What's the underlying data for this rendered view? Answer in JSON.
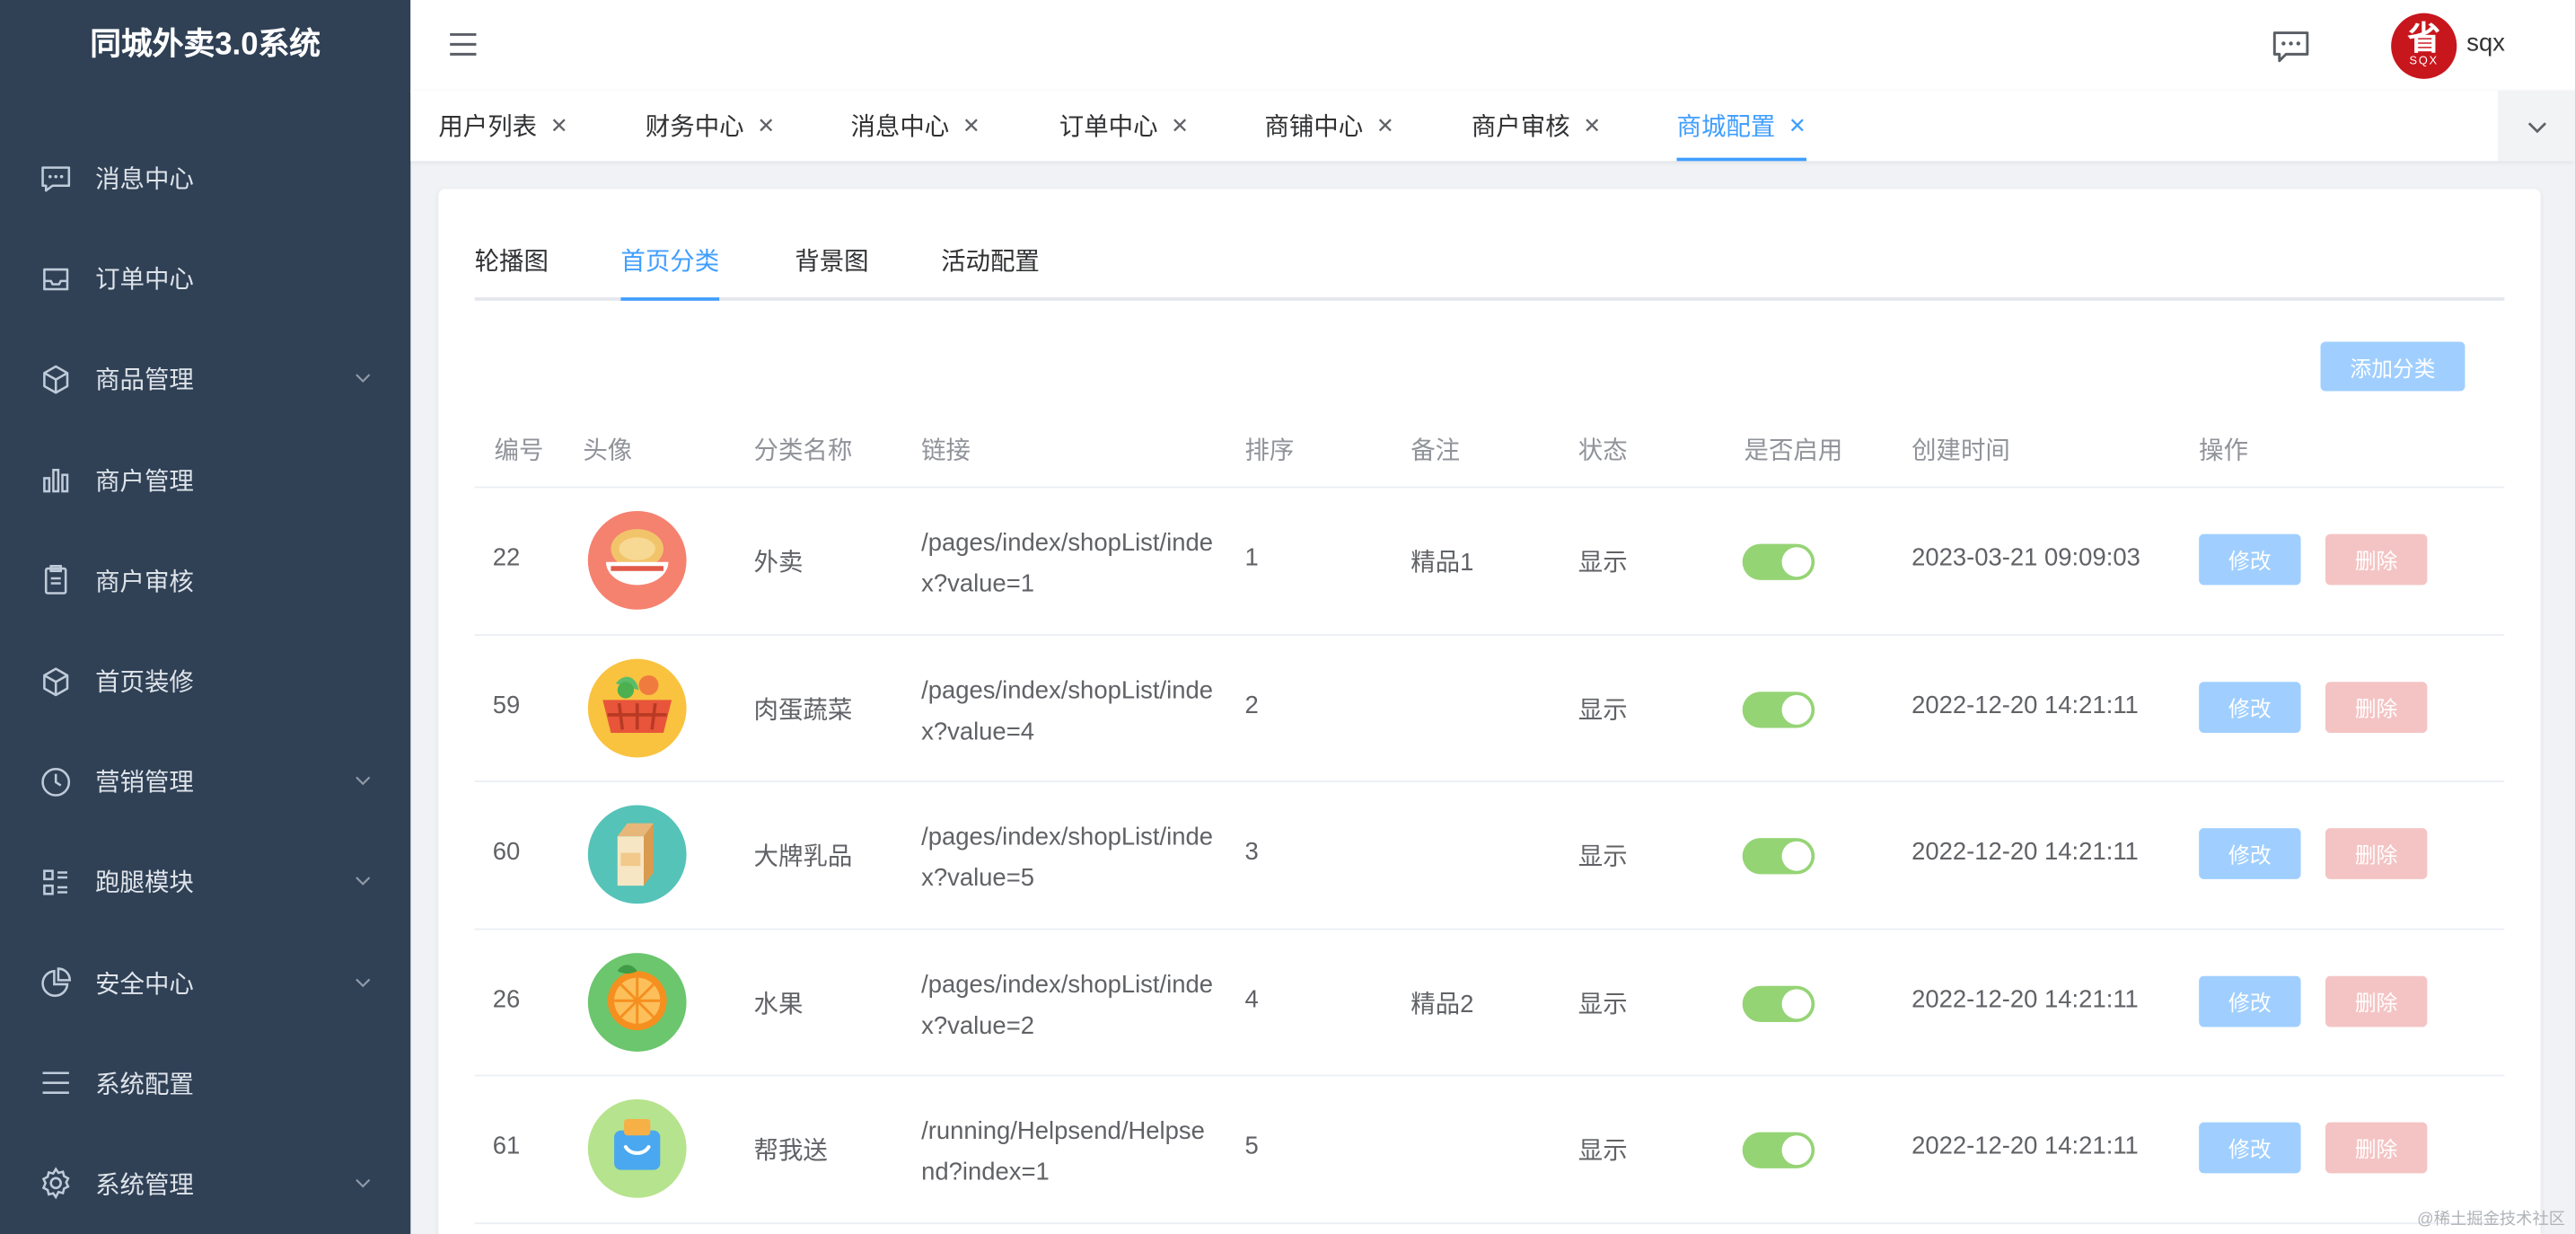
{
  "app": {
    "title": "同城外卖3.0系统"
  },
  "sidebar": {
    "items": [
      {
        "label": "消息中心",
        "icon": "message-icon",
        "has_arrow": false
      },
      {
        "label": "订单中心",
        "icon": "inbox-icon",
        "has_arrow": false
      },
      {
        "label": "商品管理",
        "icon": "box-icon",
        "has_arrow": true
      },
      {
        "label": "商户管理",
        "icon": "bar-chart-icon",
        "has_arrow": false
      },
      {
        "label": "商户审核",
        "icon": "clipboard-icon",
        "has_arrow": false
      },
      {
        "label": "首页装修",
        "icon": "box-icon",
        "has_arrow": false
      },
      {
        "label": "营销管理",
        "icon": "clock-icon",
        "has_arrow": true
      },
      {
        "label": "跑腿模块",
        "icon": "list-icon",
        "has_arrow": true
      },
      {
        "label": "安全中心",
        "icon": "pie-chart-icon",
        "has_arrow": true
      },
      {
        "label": "系统配置",
        "icon": "menu-icon",
        "has_arrow": false
      },
      {
        "label": "系统管理",
        "icon": "gear-icon",
        "has_arrow": true
      }
    ]
  },
  "header": {
    "avatar": {
      "main": "省",
      "sub": "SQX"
    },
    "username": "sqx"
  },
  "tags": [
    {
      "label": "用户列表",
      "active": false
    },
    {
      "label": "财务中心",
      "active": false
    },
    {
      "label": "消息中心",
      "active": false
    },
    {
      "label": "订单中心",
      "active": false
    },
    {
      "label": "商铺中心",
      "active": false
    },
    {
      "label": "商户审核",
      "active": false
    },
    {
      "label": "商城配置",
      "active": true
    }
  ],
  "sub_tabs": [
    {
      "label": "轮播图",
      "active": false
    },
    {
      "label": "首页分类",
      "active": true
    },
    {
      "label": "背景图",
      "active": false
    },
    {
      "label": "活动配置",
      "active": false
    }
  ],
  "actions": {
    "add_label": "添加分类"
  },
  "table": {
    "columns": [
      "编号",
      "头像",
      "分类名称",
      "链接",
      "排序",
      "备注",
      "状态",
      "是否启用",
      "创建时间",
      "操作"
    ],
    "rows": [
      {
        "id": "22",
        "image": "bowl-icon",
        "name": "外卖",
        "link": "/pages/index/shopList/index?value=1",
        "sort": "1",
        "remark": "精品1",
        "status": "显示",
        "enabled": true,
        "created": "2023-03-21 09:09:03",
        "edit": "修改",
        "delete": "删除"
      },
      {
        "id": "59",
        "image": "basket-icon",
        "name": "肉蛋蔬菜",
        "link": "/pages/index/shopList/index?value=4",
        "sort": "2",
        "remark": "",
        "status": "显示",
        "enabled": true,
        "created": "2022-12-20 14:21:11",
        "edit": "修改",
        "delete": "删除"
      },
      {
        "id": "60",
        "image": "milk-icon",
        "name": "大牌乳品",
        "link": "/pages/index/shopList/index?value=5",
        "sort": "3",
        "remark": "",
        "status": "显示",
        "enabled": true,
        "created": "2022-12-20 14:21:11",
        "edit": "修改",
        "delete": "删除"
      },
      {
        "id": "26",
        "image": "orange-icon",
        "name": "水果",
        "link": "/pages/index/shopList/index?value=2",
        "sort": "4",
        "remark": "精品2",
        "status": "显示",
        "enabled": true,
        "created": "2022-12-20 14:21:11",
        "edit": "修改",
        "delete": "删除"
      },
      {
        "id": "61",
        "image": "parcel-icon",
        "name": "帮我送",
        "link": "/running/Helpsend/Helpsend?index=1",
        "sort": "5",
        "remark": "",
        "status": "显示",
        "enabled": true,
        "created": "2022-12-20 14:21:11",
        "edit": "修改",
        "delete": "删除"
      }
    ]
  },
  "watermark": "@稀土掘金技术社区"
}
